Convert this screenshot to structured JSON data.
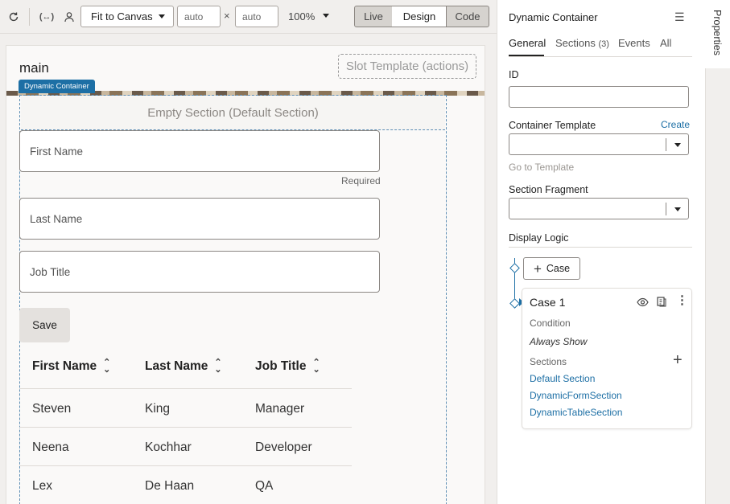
{
  "toolbar": {
    "fit_label": "Fit to Canvas",
    "width_value": "auto",
    "times": "×",
    "height_value": "auto",
    "zoom": "100%",
    "modes": [
      "Live",
      "Design",
      "Code"
    ],
    "active_mode": "Design"
  },
  "canvas": {
    "page_title": "main",
    "slot_template": "Slot Template (actions)",
    "container_badge": "Dynamic Container",
    "empty_section": "Empty Section (Default Section)",
    "fields": [
      {
        "placeholder": "First Name",
        "helper": "Required"
      },
      {
        "placeholder": "Last Name"
      },
      {
        "placeholder": "Job Title"
      }
    ],
    "save_label": "Save",
    "table": {
      "columns": [
        "First Name",
        "Last Name",
        "Job Title"
      ],
      "rows": [
        [
          "Steven",
          "King",
          "Manager"
        ],
        [
          "Neena",
          "Kochhar",
          "Developer"
        ],
        [
          "Lex",
          "De Haan",
          "QA"
        ]
      ]
    }
  },
  "panel": {
    "title": "Dynamic Container",
    "side_tab": "Properties",
    "tabs": [
      {
        "label": "General",
        "count": ""
      },
      {
        "label": "Sections",
        "count": "(3)"
      },
      {
        "label": "Events",
        "count": ""
      },
      {
        "label": "All",
        "count": ""
      }
    ],
    "id_label": "ID",
    "id_value": "",
    "container_template_label": "Container Template",
    "create_link": "Create",
    "go_to_template": "Go to Template",
    "section_fragment_label": "Section Fragment",
    "display_logic_label": "Display Logic",
    "add_case_label": "Case",
    "case": {
      "name": "Case 1",
      "condition_label": "Condition",
      "condition_value": "Always Show",
      "sections_label": "Sections",
      "sections": [
        "Default Section",
        "DynamicFormSection",
        "DynamicTableSection"
      ]
    }
  },
  "colors": {
    "accent": "#1d6fa5",
    "badge": "#1d6fa5"
  }
}
